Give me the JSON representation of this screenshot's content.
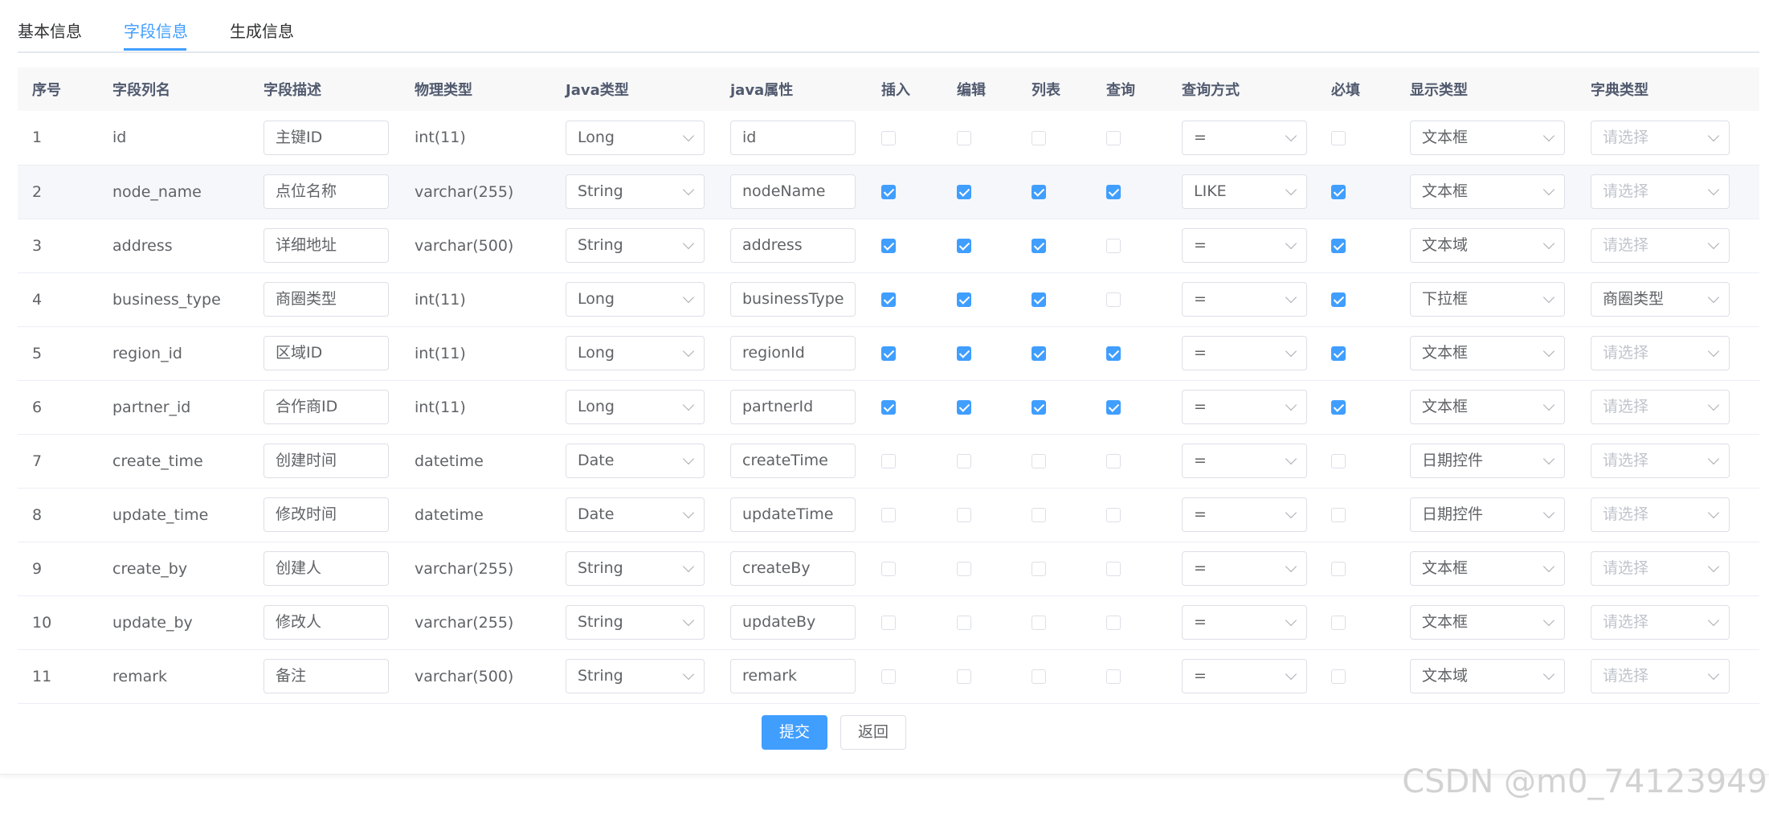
{
  "tabs": [
    "基本信息",
    "字段信息",
    "生成信息"
  ],
  "active_tab_index": 1,
  "columns": [
    "序号",
    "字段列名",
    "字段描述",
    "物理类型",
    "Java类型",
    "java属性",
    "插入",
    "编辑",
    "列表",
    "查询",
    "查询方式",
    "必填",
    "显示类型",
    "字典类型"
  ],
  "dict_placeholder": "请选择",
  "rows": [
    {
      "no": "1",
      "column": "id",
      "desc": "主键ID",
      "phys": "int(11)",
      "java_type": "Long",
      "java_prop": "id",
      "insert": false,
      "edit": false,
      "list": false,
      "query": false,
      "query_type": "=",
      "required": false,
      "html_type": "文本框",
      "dict": ""
    },
    {
      "no": "2",
      "column": "node_name",
      "desc": "点位名称",
      "phys": "varchar(255)",
      "java_type": "String",
      "java_prop": "nodeName",
      "insert": true,
      "edit": true,
      "list": true,
      "query": true,
      "query_type": "LIKE",
      "required": true,
      "html_type": "文本框",
      "dict": ""
    },
    {
      "no": "3",
      "column": "address",
      "desc": "详细地址",
      "phys": "varchar(500)",
      "java_type": "String",
      "java_prop": "address",
      "insert": true,
      "edit": true,
      "list": true,
      "query": false,
      "query_type": "=",
      "required": true,
      "html_type": "文本域",
      "dict": ""
    },
    {
      "no": "4",
      "column": "business_type",
      "desc": "商圈类型",
      "phys": "int(11)",
      "java_type": "Long",
      "java_prop": "businessType",
      "insert": true,
      "edit": true,
      "list": true,
      "query": false,
      "query_type": "=",
      "required": true,
      "html_type": "下拉框",
      "dict": "商圈类型"
    },
    {
      "no": "5",
      "column": "region_id",
      "desc": "区域ID",
      "phys": "int(11)",
      "java_type": "Long",
      "java_prop": "regionId",
      "insert": true,
      "edit": true,
      "list": true,
      "query": true,
      "query_type": "=",
      "required": true,
      "html_type": "文本框",
      "dict": ""
    },
    {
      "no": "6",
      "column": "partner_id",
      "desc": "合作商ID",
      "phys": "int(11)",
      "java_type": "Long",
      "java_prop": "partnerId",
      "insert": true,
      "edit": true,
      "list": true,
      "query": true,
      "query_type": "=",
      "required": true,
      "html_type": "文本框",
      "dict": ""
    },
    {
      "no": "7",
      "column": "create_time",
      "desc": "创建时间",
      "phys": "datetime",
      "java_type": "Date",
      "java_prop": "createTime",
      "insert": false,
      "edit": false,
      "list": false,
      "query": false,
      "query_type": "=",
      "required": false,
      "html_type": "日期控件",
      "dict": ""
    },
    {
      "no": "8",
      "column": "update_time",
      "desc": "修改时间",
      "phys": "datetime",
      "java_type": "Date",
      "java_prop": "updateTime",
      "insert": false,
      "edit": false,
      "list": false,
      "query": false,
      "query_type": "=",
      "required": false,
      "html_type": "日期控件",
      "dict": ""
    },
    {
      "no": "9",
      "column": "create_by",
      "desc": "创建人",
      "phys": "varchar(255)",
      "java_type": "String",
      "java_prop": "createBy",
      "insert": false,
      "edit": false,
      "list": false,
      "query": false,
      "query_type": "=",
      "required": false,
      "html_type": "文本框",
      "dict": ""
    },
    {
      "no": "10",
      "column": "update_by",
      "desc": "修改人",
      "phys": "varchar(255)",
      "java_type": "String",
      "java_prop": "updateBy",
      "insert": false,
      "edit": false,
      "list": false,
      "query": false,
      "query_type": "=",
      "required": false,
      "html_type": "文本框",
      "dict": ""
    },
    {
      "no": "11",
      "column": "remark",
      "desc": "备注",
      "phys": "varchar(500)",
      "java_type": "String",
      "java_prop": "remark",
      "insert": false,
      "edit": false,
      "list": false,
      "query": false,
      "query_type": "=",
      "required": false,
      "html_type": "文本域",
      "dict": ""
    }
  ],
  "highlighted_row_index": 1,
  "buttons": {
    "submit": "提交",
    "back": "返回"
  },
  "watermark": "CSDN @m0_74123949",
  "colors": {
    "accent": "#409eff",
    "header_bg": "#f8f8f9",
    "border": "#dcdfe6"
  }
}
